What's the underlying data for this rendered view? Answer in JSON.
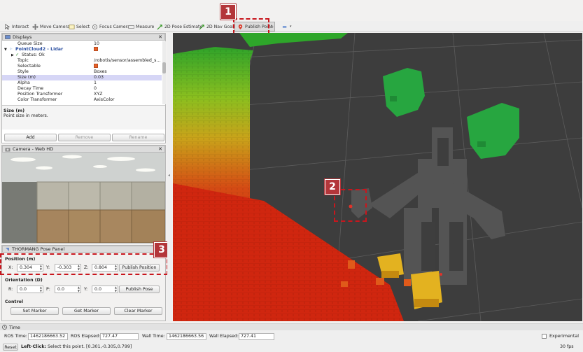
{
  "toolbar": {
    "interact": "Interact",
    "move_camera": "Move Camera",
    "select": "Select",
    "focus_camera": "Focus Camera",
    "measure": "Measure",
    "pose_estimate": "2D Pose Estimate",
    "nav_goal": "2D Nav Goal",
    "publish_point": "Publish Point"
  },
  "displays": {
    "title": "Displays",
    "rows": [
      {
        "k": "Queue Size",
        "v": "10"
      },
      {
        "k": "PointCloud2 - Lidar",
        "v": ""
      },
      {
        "k": "Status: Ok",
        "v": ""
      },
      {
        "k": "Topic",
        "v": "/robotis/sensor/assembled_s..."
      },
      {
        "k": "Selectable",
        "v": ""
      },
      {
        "k": "Style",
        "v": "Boxes"
      },
      {
        "k": "Size (m)",
        "v": "0.03"
      },
      {
        "k": "Alpha",
        "v": "1"
      },
      {
        "k": "Decay Time",
        "v": "0"
      },
      {
        "k": "Position Transformer",
        "v": "XYZ"
      },
      {
        "k": "Color Transformer",
        "v": "AxisColor"
      }
    ],
    "help_title": "Size (m)",
    "help_text": "Point size in meters.",
    "add": "Add",
    "remove": "Remove",
    "rename": "Rename"
  },
  "camera": {
    "title": "Camera - Web HD"
  },
  "pose_panel": {
    "title": "THORMANG Pose Panel",
    "position_label": "Position (m)",
    "x_label": "X:",
    "x": "0.304",
    "y_label": "Y:",
    "y": "-0.303",
    "z_label": "Z:",
    "z": "0.804",
    "publish_position": "Publish Position",
    "orientation_label": "Orientation (D)",
    "r_label": "R:",
    "r": "0.0",
    "p_label": "P:",
    "p": "0.0",
    "yaw_label": "Y:",
    "yaw": "0.0",
    "publish_pose": "Publish Pose",
    "control_label": "Control",
    "set_marker": "Set Marker",
    "get_marker": "Get Marker",
    "clear_marker": "Clear Marker"
  },
  "time": {
    "title": "Time",
    "ros_time_label": "ROS Time:",
    "ros_time": "1462186663.52",
    "ros_elapsed_label": "ROS Elapsed:",
    "ros_elapsed": "727.47",
    "wall_time_label": "Wall Time:",
    "wall_time": "1462186663.56",
    "wall_elapsed_label": "Wall Elapsed:",
    "wall_elapsed": "727.41",
    "experimental": "Experimental"
  },
  "status": {
    "reset": "Reset",
    "hint_bold": "Left-Click:",
    "hint": " Select this point. [0.301,-0.305,0.799]",
    "fps": "30 fps"
  },
  "callouts": [
    "1",
    "2",
    "3"
  ],
  "colors": {
    "callout": "#c8161d",
    "badge": "#b3363a",
    "selection": "#d6d6f6"
  }
}
